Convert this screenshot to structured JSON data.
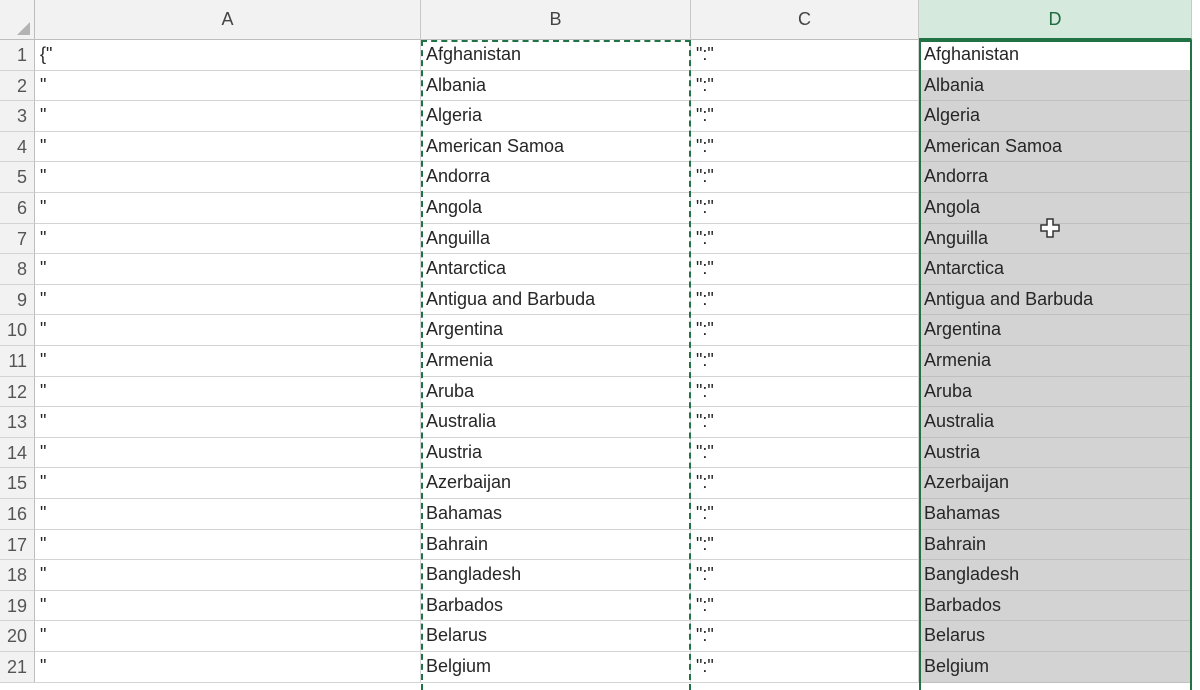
{
  "columns": [
    "A",
    "B",
    "C",
    "D"
  ],
  "selected_column": "D",
  "rows": [
    {
      "n": "1",
      "a": "{\"",
      "b": "Afghanistan",
      "c": "\":\"",
      "d": "Afghanistan"
    },
    {
      "n": "2",
      "a": "\"",
      "b": "Albania",
      "c": "\":\"",
      "d": "Albania"
    },
    {
      "n": "3",
      "a": "\"",
      "b": "Algeria",
      "c": "\":\"",
      "d": "Algeria"
    },
    {
      "n": "4",
      "a": "\"",
      "b": "American Samoa",
      "c": "\":\"",
      "d": "American Samoa"
    },
    {
      "n": "5",
      "a": "\"",
      "b": "Andorra",
      "c": "\":\"",
      "d": "Andorra"
    },
    {
      "n": "6",
      "a": "\"",
      "b": "Angola",
      "c": "\":\"",
      "d": "Angola"
    },
    {
      "n": "7",
      "a": "\"",
      "b": "Anguilla",
      "c": "\":\"",
      "d": "Anguilla"
    },
    {
      "n": "8",
      "a": "\"",
      "b": "Antarctica",
      "c": "\":\"",
      "d": "Antarctica"
    },
    {
      "n": "9",
      "a": "\"",
      "b": "Antigua and Barbuda",
      "c": "\":\"",
      "d": "Antigua and Barbuda"
    },
    {
      "n": "10",
      "a": "\"",
      "b": "Argentina",
      "c": "\":\"",
      "d": "Argentina"
    },
    {
      "n": "11",
      "a": "\"",
      "b": "Armenia",
      "c": "\":\"",
      "d": "Armenia"
    },
    {
      "n": "12",
      "a": "\"",
      "b": "Aruba",
      "c": "\":\"",
      "d": "Aruba"
    },
    {
      "n": "13",
      "a": "\"",
      "b": "Australia",
      "c": "\":\"",
      "d": "Australia"
    },
    {
      "n": "14",
      "a": "\"",
      "b": "Austria",
      "c": "\":\"",
      "d": "Austria"
    },
    {
      "n": "15",
      "a": "\"",
      "b": "Azerbaijan",
      "c": "\":\"",
      "d": "Azerbaijan"
    },
    {
      "n": "16",
      "a": "\"",
      "b": "Bahamas",
      "c": "\":\"",
      "d": "Bahamas"
    },
    {
      "n": "17",
      "a": "\"",
      "b": "Bahrain",
      "c": "\":\"",
      "d": "Bahrain"
    },
    {
      "n": "18",
      "a": "\"",
      "b": "Bangladesh",
      "c": "\":\"",
      "d": "Bangladesh"
    },
    {
      "n": "19",
      "a": "\"",
      "b": "Barbados",
      "c": "\":\"",
      "d": "Barbados"
    },
    {
      "n": "20",
      "a": "\"",
      "b": "Belarus",
      "c": "\":\"",
      "d": "Belarus"
    },
    {
      "n": "21",
      "a": "\"",
      "b": "Belgium",
      "c": "\":\"",
      "d": "Belgium"
    }
  ],
  "colors": {
    "selection": "#217346",
    "header_selected": "#d6e9dd",
    "selected_cells": "#d3d3d3"
  },
  "cursor_icon": "cell-select-cross-icon"
}
